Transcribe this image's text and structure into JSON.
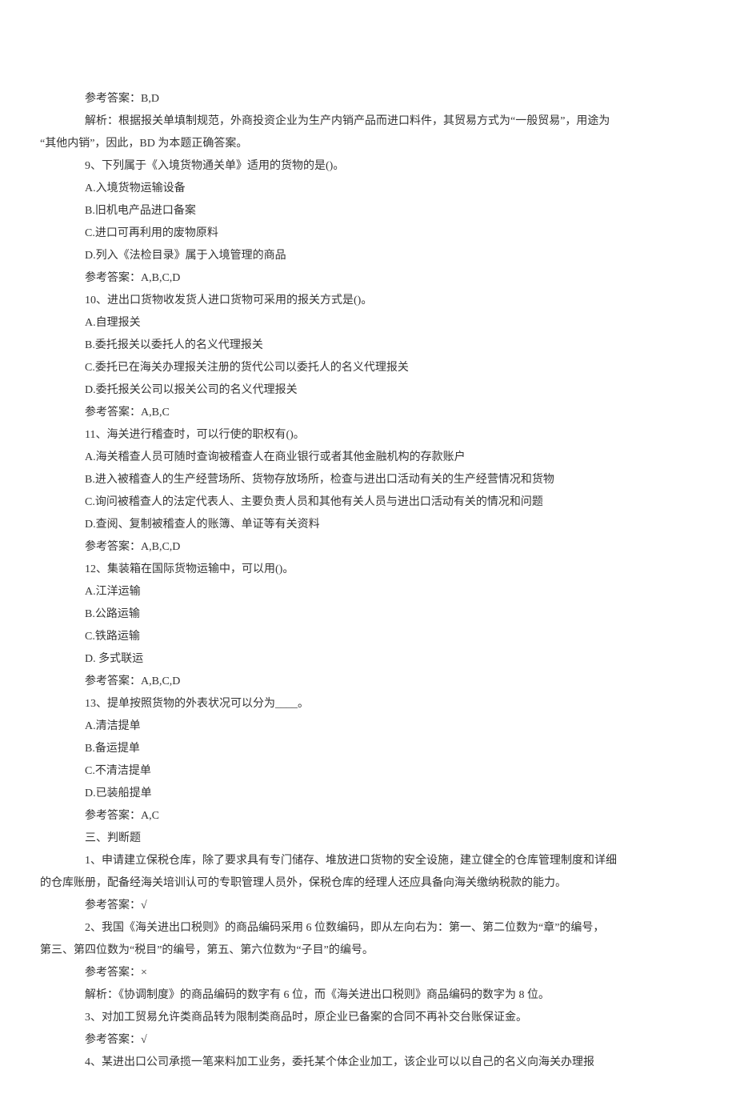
{
  "lines": [
    {
      "t": "参考答案：B,D",
      "cls": "line2"
    },
    {
      "t": "解析：根据报关单填制规范，外商投资企业为生产内销产品而进口料件，其贸易方式为“一般贸易”，用途为",
      "cls": "line2"
    },
    {
      "t": "“其他内销”，因此，BD 为本题正确答案。",
      "cls": "noindent"
    },
    {
      "t": "9、下列属于《入境货物通关单》适用的货物的是()。",
      "cls": "line2"
    },
    {
      "t": "A.入境货物运输设备",
      "cls": "line2"
    },
    {
      "t": "B.旧机电产品进口备案",
      "cls": "line2"
    },
    {
      "t": "C.进口可再利用的废物原料",
      "cls": "line2"
    },
    {
      "t": "D.列入《法检目录》属于入境管理的商品",
      "cls": "line2"
    },
    {
      "t": "参考答案：A,B,C,D",
      "cls": "line2"
    },
    {
      "t": "10、进出口货物收发货人进口货物可采用的报关方式是()。",
      "cls": "line2"
    },
    {
      "t": "A.自理报关",
      "cls": "line2"
    },
    {
      "t": "B.委托报关以委托人的名义代理报关",
      "cls": "line2"
    },
    {
      "t": "C.委托已在海关办理报关注册的货代公司以委托人的名义代理报关",
      "cls": "line2"
    },
    {
      "t": "D.委托报关公司以报关公司的名义代理报关",
      "cls": "line2"
    },
    {
      "t": "参考答案：A,B,C",
      "cls": "line2"
    },
    {
      "t": "11、海关进行稽查时，可以行使的职权有()。",
      "cls": "line2"
    },
    {
      "t": "A.海关稽查人员可随时查询被稽查人在商业银行或者其他金融机构的存款账户",
      "cls": "line2"
    },
    {
      "t": "B.进入被稽查人的生产经营场所、货物存放场所，检查与进出口活动有关的生产经营情况和货物",
      "cls": "line2"
    },
    {
      "t": "C.询问被稽查人的法定代表人、主要负责人员和其他有关人员与进出口活动有关的情况和问题",
      "cls": "line2"
    },
    {
      "t": "D.查阅、复制被稽查人的账簿、单证等有关资料",
      "cls": "line2"
    },
    {
      "t": "参考答案：A,B,C,D",
      "cls": "line2"
    },
    {
      "t": "12、集装箱在国际货物运输中，可以用()。",
      "cls": "line2"
    },
    {
      "t": "A.江洋运输",
      "cls": "line2"
    },
    {
      "t": "B.公路运输",
      "cls": "line2"
    },
    {
      "t": "C.铁路运输",
      "cls": "line2"
    },
    {
      "t": "D. 多式联运",
      "cls": "line2"
    },
    {
      "t": "参考答案：A,B,C,D",
      "cls": "line2"
    },
    {
      "t": "13、提单按照货物的外表状况可以分为____。",
      "cls": "line2"
    },
    {
      "t": "A.清洁提单",
      "cls": "line2"
    },
    {
      "t": "B.备运提单",
      "cls": "line2"
    },
    {
      "t": "C.不清洁提单",
      "cls": "line2"
    },
    {
      "t": "D.已装船提单",
      "cls": "line2"
    },
    {
      "t": "参考答案：A,C",
      "cls": "line2"
    },
    {
      "t": "三、判断题",
      "cls": "line2"
    },
    {
      "t": "1、申请建立保税仓库，除了要求具有专门储存、堆放进口货物的安全设施，建立健全的仓库管理制度和详细",
      "cls": "line2"
    },
    {
      "t": "的仓库账册，配备经海关培训认可的专职管理人员外，保税仓库的经理人还应具备向海关缴纳税款的能力。",
      "cls": "noindent"
    },
    {
      "t": "参考答案：√",
      "cls": "line2"
    },
    {
      "t": "2、我国《海关进出口税则》的商品编码采用 6 位数编码，即从左向右为：第一、第二位数为“章”的编号，",
      "cls": "line2"
    },
    {
      "t": "第三、第四位数为“税目”的编号，第五、第六位数为“子目”的编号。",
      "cls": "noindent"
    },
    {
      "t": "参考答案：×",
      "cls": "line2"
    },
    {
      "t": "解析：《协调制度》的商品编码的数字有 6 位，而《海关进出口税则》商品编码的数字为 8 位。",
      "cls": "line2"
    },
    {
      "t": "3、对加工贸易允许类商品转为限制类商品时，原企业已备案的合同不再补交台账保证金。",
      "cls": "line2"
    },
    {
      "t": "参考答案：√",
      "cls": "line2"
    },
    {
      "t": "4、某进出口公司承揽一笔来料加工业务，委托某个体企业加工，该企业可以以自己的名义向海关办理报",
      "cls": "line2"
    }
  ]
}
